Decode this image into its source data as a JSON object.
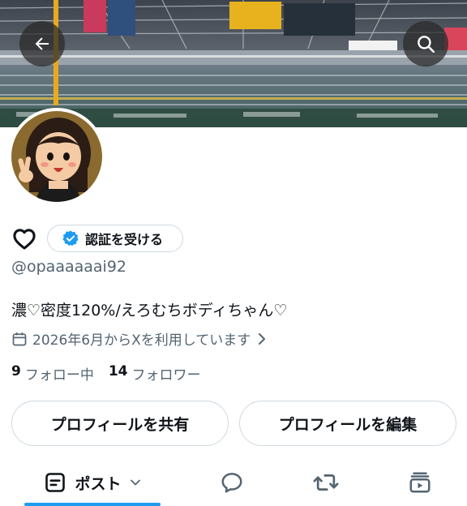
{
  "profile": {
    "handle": "@opaaaaaai92",
    "bio": "濃♡密度120%/えろむちボディちゃん♡",
    "joined": "2026年6月からXを利用しています",
    "following_count": "9",
    "following_label": "フォロー中",
    "followers_count": "14",
    "followers_label": "フォロワー"
  },
  "verify": {
    "label": "認証を受ける"
  },
  "buttons": {
    "share": "プロフィールを共有",
    "edit": "プロフィールを編集"
  },
  "tabs": {
    "posts_label": "ポスト"
  },
  "icons": {
    "back": "back-arrow-icon",
    "search": "search-icon",
    "heart": "heart-outline-icon",
    "verified": "verified-badge-icon",
    "calendar": "calendar-icon",
    "chevron": "chevron-right-icon",
    "posts": "posts-icon",
    "dropdown": "chevron-down-icon",
    "replies": "reply-icon",
    "reposts": "repost-icon",
    "media": "media-icon"
  },
  "colors": {
    "accent": "#1d9bf0",
    "text": "#0f1419",
    "muted": "#536471",
    "border": "#cfd9de"
  }
}
